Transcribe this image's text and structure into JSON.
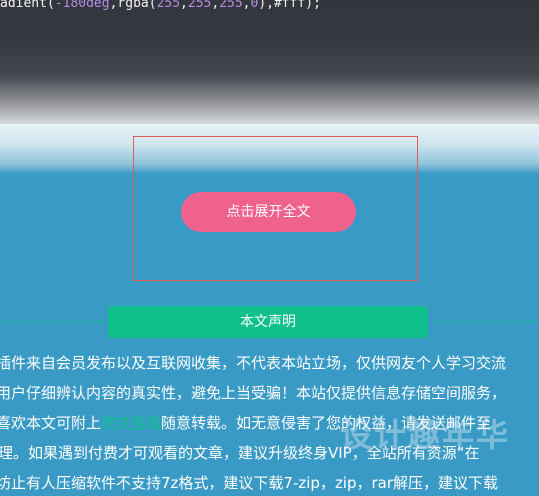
{
  "code": {
    "prefix": "adient(",
    "angle": "-180deg",
    "middle": ",rgba(",
    "c1": "255",
    "c2": "255",
    "c3": "255",
    "c4": "0",
    "suffix": "),#fff);"
  },
  "expand_button": {
    "label": "点击展开全文"
  },
  "notice": {
    "title": "本文声明",
    "lines": [
      "插件来自会员发布以及互联网收集，不代表本站立场，仅供网友个人学习交流",
      "用户仔细辨认内容的真实性，避免上当受骗！本站仅提供信息存储空间服务，",
      "喜欢本文可附上",
      "随意转载。如无意侵害了您的权益，请发送邮件至",
      "理。如果遇到付费才可观看的文章，建议升级终身VIP，全站所有资源“在",
      "坊止有人压缩软件不支持7z格式，建议下载7-zip，zip，rar解压，建议下载"
    ],
    "link_text": "原文链接"
  },
  "watermark": "设计趣年华",
  "colors": {
    "background": "#3a9ac6",
    "button": "#f0628e",
    "accent_green": "#0fc08b",
    "mask_border": "#e05a5a"
  }
}
